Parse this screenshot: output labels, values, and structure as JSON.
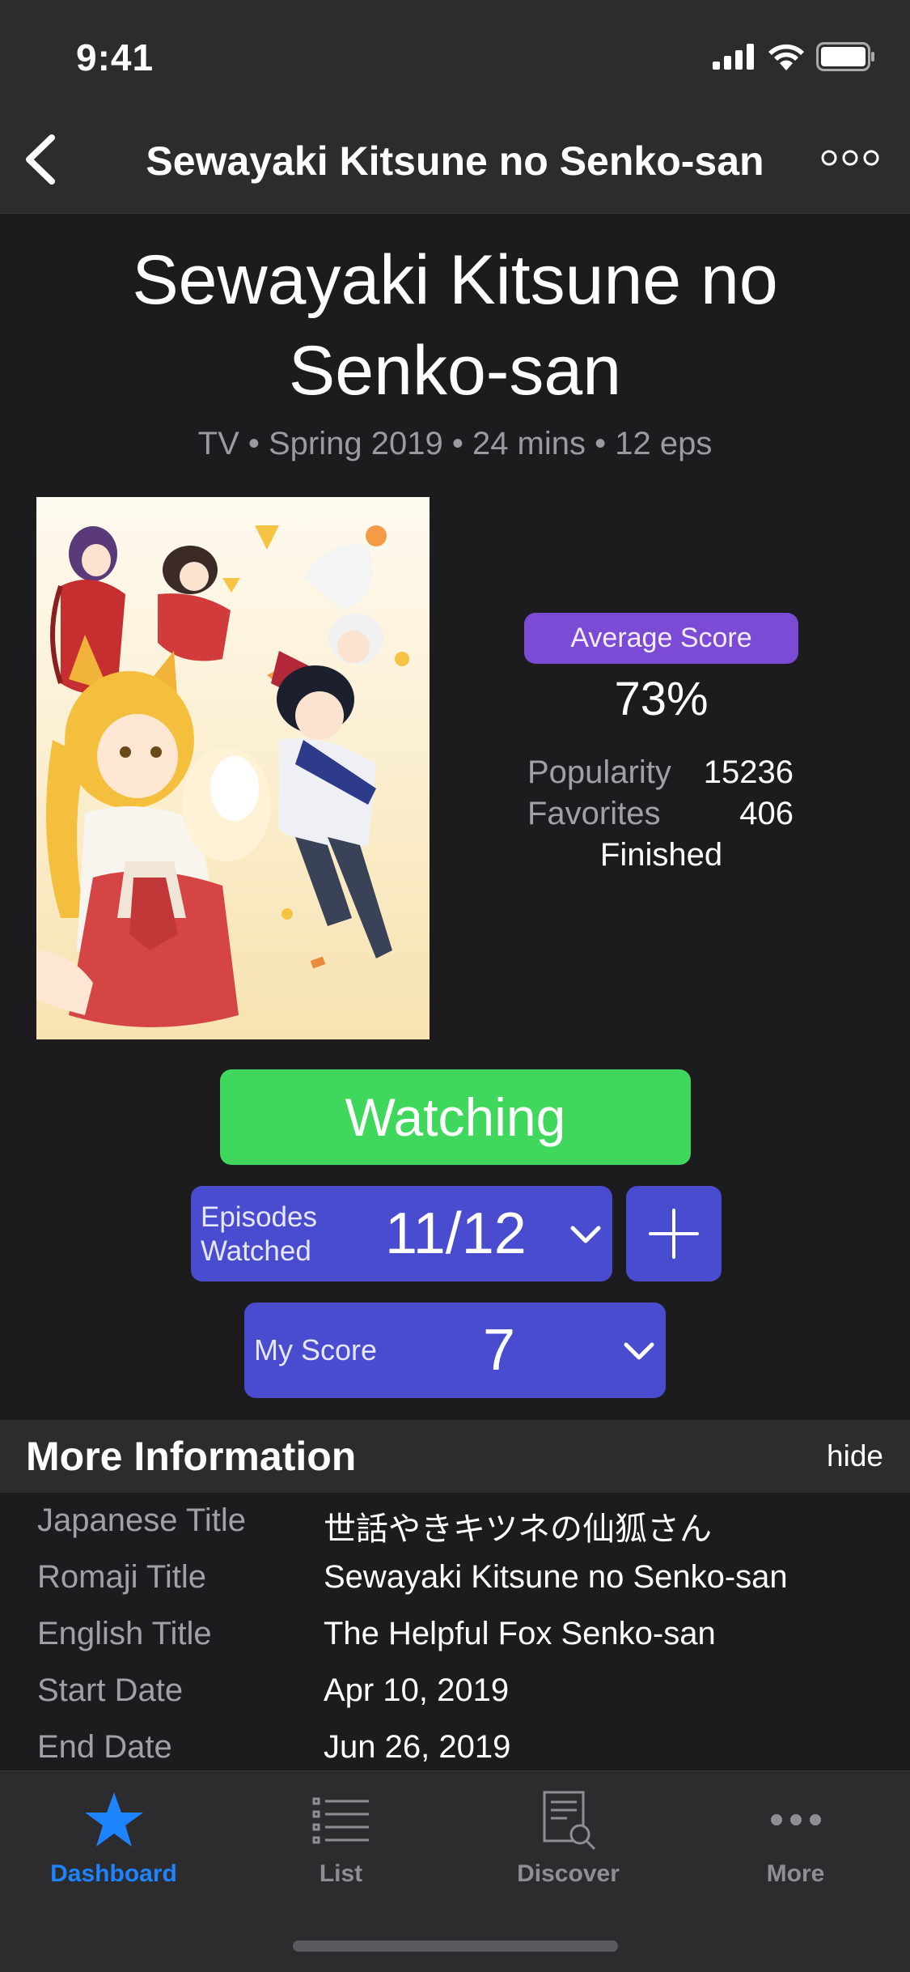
{
  "status_bar": {
    "time": "9:41"
  },
  "nav": {
    "title": "Sewayaki Kitsune no Senko-san"
  },
  "anime": {
    "title": "Sewayaki Kitsune no Senko-san",
    "meta": "TV • Spring 2019 • 24 mins • 12 eps"
  },
  "stats": {
    "average_score_label": "Average Score",
    "average_score": "73%",
    "popularity_label": "Popularity",
    "popularity": "15236",
    "favorites_label": "Favorites",
    "favorites": "406",
    "status": "Finished"
  },
  "controls": {
    "watching_label": "Watching",
    "episodes_label": "Episodes Watched",
    "episodes_value": "11/12",
    "my_score_label": "My Score",
    "my_score_value": "7"
  },
  "more_info": {
    "title": "More Information",
    "hide_label": "hide",
    "rows": [
      {
        "label": "Japanese Title",
        "value": "世話やきキツネの仙狐さん"
      },
      {
        "label": "Romaji Title",
        "value": "Sewayaki Kitsune no Senko-san"
      },
      {
        "label": "English Title",
        "value": "The Helpful Fox Senko-san"
      },
      {
        "label": "Start Date",
        "value": "Apr 10, 2019"
      },
      {
        "label": "End Date",
        "value": "Jun 26, 2019"
      }
    ]
  },
  "tabs": [
    {
      "label": "Dashboard",
      "icon": "star-icon",
      "active": true
    },
    {
      "label": "List",
      "icon": "list-icon",
      "active": false
    },
    {
      "label": "Discover",
      "icon": "discover-icon",
      "active": false
    },
    {
      "label": "More",
      "icon": "more-dots-icon",
      "active": false
    }
  ],
  "colors": {
    "accent_blue": "#1e83ff",
    "watching_green": "#3fd85c",
    "control_blue": "#4a4ccf",
    "score_badge_purple": "#7b4bd6"
  }
}
